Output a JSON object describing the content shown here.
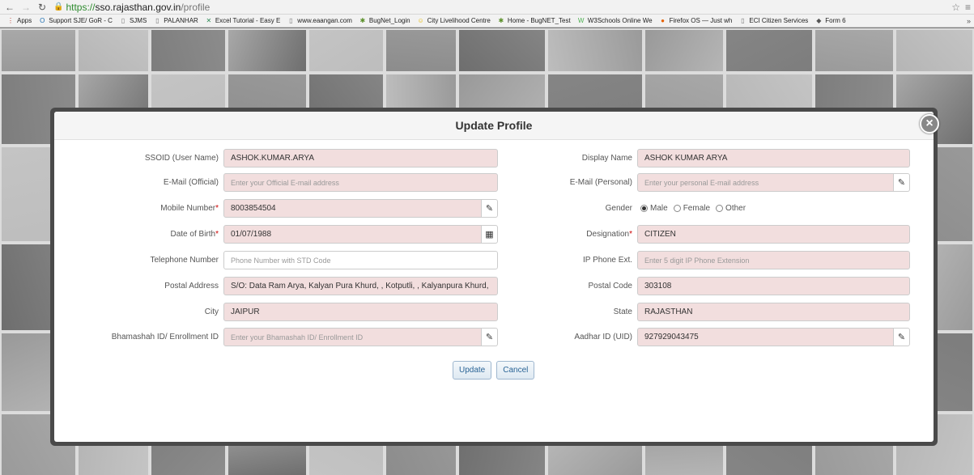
{
  "browser": {
    "url_proto": "https://",
    "url_host": "sso.rajasthan.gov.in",
    "url_path": "/profile",
    "bookmarks": [
      {
        "label": "Apps",
        "icon": "apps-grid-icon",
        "color": "#c0392b"
      },
      {
        "label": "Support SJE/ GoR - C",
        "icon": "o-icon",
        "color": "#1f6fb2"
      },
      {
        "label": "SJMS",
        "icon": "page-icon",
        "color": "#777777"
      },
      {
        "label": "PALANHAR",
        "icon": "page-icon",
        "color": "#777777"
      },
      {
        "label": "Excel Tutorial - Easy E",
        "icon": "excel-icon",
        "color": "#2e8b57"
      },
      {
        "label": "www.eaangan.com",
        "icon": "page-icon",
        "color": "#777777"
      },
      {
        "label": "BugNet_Login",
        "icon": "bug-icon",
        "color": "#5a8f29"
      },
      {
        "label": "City Livelihood Centre",
        "icon": "smiley-icon",
        "color": "#e6b800"
      },
      {
        "label": "Home - BugNET_Test",
        "icon": "bug-icon",
        "color": "#5a8f29"
      },
      {
        "label": "W3Schools Online We",
        "icon": "w3-icon",
        "color": "#4caf50"
      },
      {
        "label": "Firefox OS — Just wh",
        "icon": "firefox-icon",
        "color": "#e66000"
      },
      {
        "label": "ECI Citizen Services",
        "icon": "page-icon",
        "color": "#777777"
      },
      {
        "label": "Form 6",
        "icon": "diamond-icon",
        "color": "#555555"
      }
    ],
    "more": "»"
  },
  "modal": {
    "title": "Update Profile",
    "close": "×",
    "left": [
      {
        "label": "SSOID (User Name)",
        "required": false,
        "value": "ASHOK.KUMAR.ARYA",
        "placeholder": "",
        "addon": "",
        "style": "pink"
      },
      {
        "label": "E-Mail (Official)",
        "required": false,
        "value": "",
        "placeholder": "Enter your Official E-mail address",
        "addon": "",
        "style": "pink"
      },
      {
        "label": "Mobile Number",
        "required": true,
        "value": "8003854504",
        "placeholder": "",
        "addon": "edit-icon",
        "style": "pink"
      },
      {
        "label": "Date of Birth",
        "required": true,
        "value": "01/07/1988",
        "placeholder": "",
        "addon": "calendar-icon",
        "style": "pink"
      },
      {
        "label": "Telephone Number",
        "required": false,
        "value": "",
        "placeholder": "Phone Number with STD Code",
        "addon": "",
        "style": "white"
      },
      {
        "label": "Postal Address",
        "required": false,
        "value": "S/O: Data Ram Arya, Kalyan Pura Khurd, , Kotputli, , Kalyanpura Khurd,",
        "placeholder": "",
        "addon": "",
        "style": "pink"
      },
      {
        "label": "City",
        "required": false,
        "value": "JAIPUR",
        "placeholder": "",
        "addon": "",
        "style": "pink"
      },
      {
        "label": "Bhamashah ID/ Enrollment ID",
        "required": false,
        "value": "",
        "placeholder": "Enter your Bhamashah ID/ Enrollment ID",
        "addon": "edit-icon",
        "style": "pink"
      }
    ],
    "right": [
      {
        "label": "Display Name",
        "required": false,
        "value": "ASHOK KUMAR ARYA",
        "placeholder": "",
        "addon": "",
        "style": "pink"
      },
      {
        "label": "E-Mail (Personal)",
        "required": false,
        "value": "",
        "placeholder": "Enter your personal E-mail address",
        "addon": "edit-icon",
        "style": "pink"
      },
      {
        "label": "Gender",
        "required": false,
        "type": "radio"
      },
      {
        "label": "Designation",
        "required": true,
        "value": "CITIZEN",
        "placeholder": "",
        "addon": "",
        "style": "pink"
      },
      {
        "label": "IP Phone Ext.",
        "required": false,
        "value": "",
        "placeholder": "Enter 5 digit IP Phone Extension",
        "addon": "",
        "style": "pink"
      },
      {
        "label": "Postal Code",
        "required": false,
        "value": "303108",
        "placeholder": "",
        "addon": "",
        "style": "pink"
      },
      {
        "label": "State",
        "required": false,
        "value": "RAJASTHAN",
        "placeholder": "",
        "addon": "",
        "style": "pink"
      },
      {
        "label": "Aadhar ID (UID)",
        "required": false,
        "value": "927929043475",
        "placeholder": "",
        "addon": "edit-icon",
        "style": "pink"
      }
    ],
    "gender": {
      "options": [
        "Male",
        "Female",
        "Other"
      ],
      "selected": "Male"
    },
    "update_label": "Update",
    "cancel_label": "Cancel"
  }
}
